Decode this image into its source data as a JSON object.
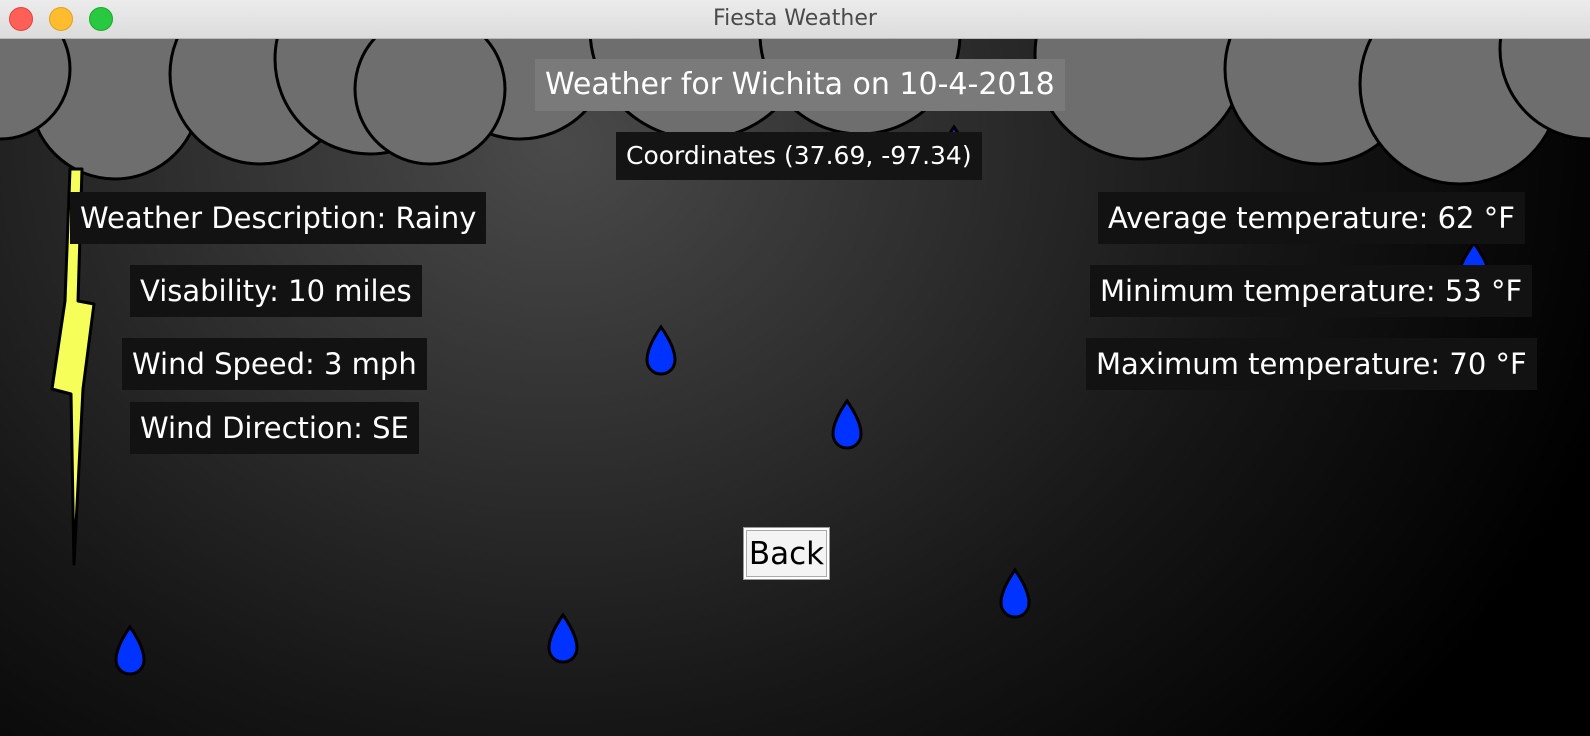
{
  "window": {
    "title": "Fiesta Weather"
  },
  "header": {
    "title": "Weather for Wichita on 10-4-2018",
    "coordinates": "Coordinates (37.69, -97.34)"
  },
  "details": {
    "description": "Weather Description: Rainy",
    "visibility": "Visability: 10 miles",
    "wind_speed": "Wind Speed: 3 mph",
    "wind_direction": "Wind Direction: SE"
  },
  "temperatures": {
    "average": "Average temperature: 62 °F",
    "minimum": "Minimum temperature: 53 °F",
    "maximum": "Maximum temperature: 70 °F"
  },
  "actions": {
    "back_label": "Back"
  },
  "colors": {
    "cloud": "#6e6e6e",
    "raindrop": "#0033ff",
    "lightning": "#f6ff5a"
  },
  "icons": [
    "cloud-icon",
    "raindrop-icon",
    "lightning-bolt-icon"
  ]
}
